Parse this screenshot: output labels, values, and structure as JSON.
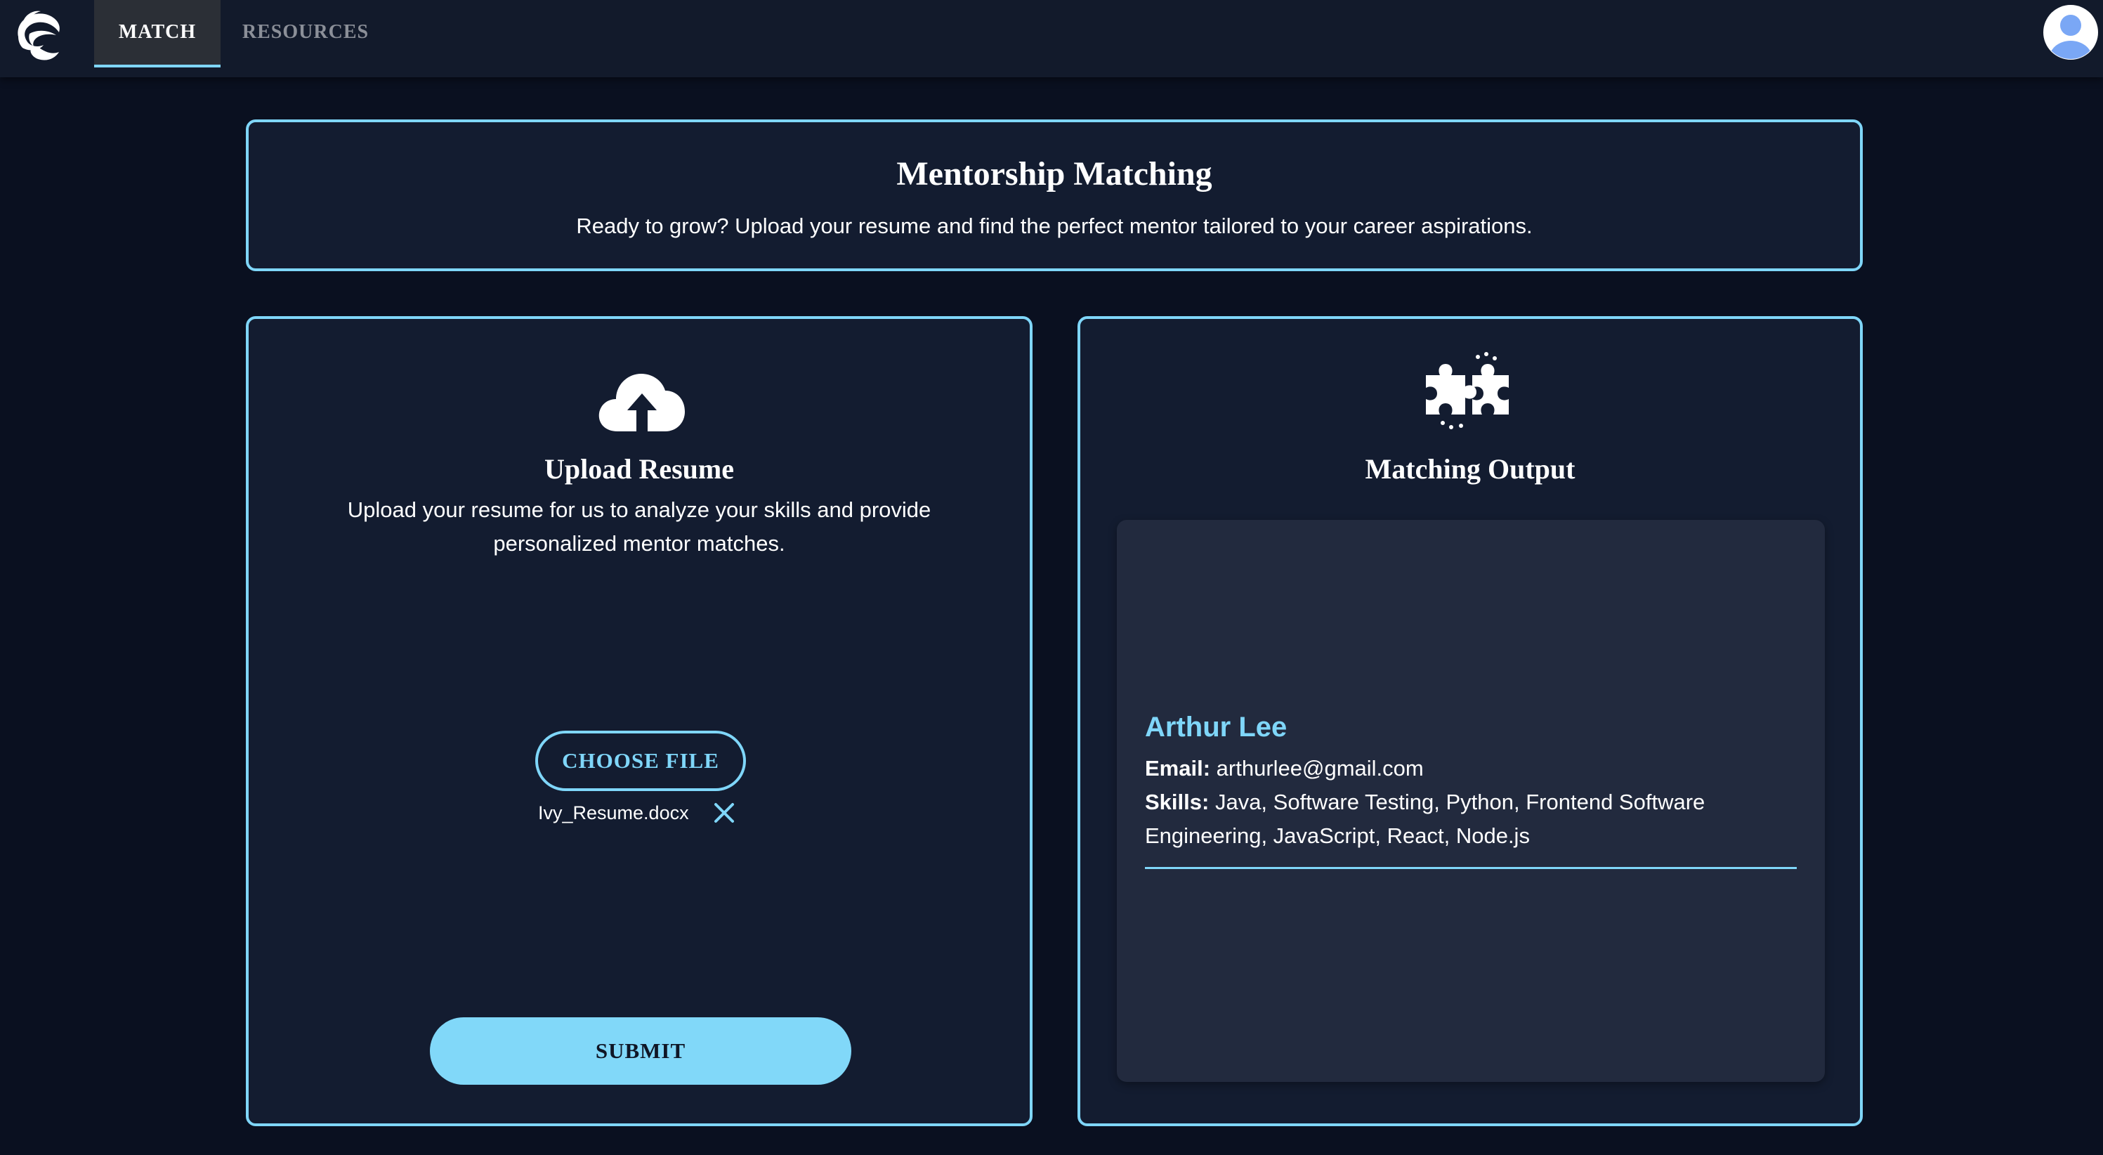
{
  "nav": {
    "tabs": [
      {
        "label": "MATCH",
        "active": true
      },
      {
        "label": "RESOURCES",
        "active": false
      }
    ]
  },
  "header": {
    "title": "Mentorship Matching",
    "subtitle": "Ready to grow? Upload your resume and find the perfect mentor tailored to your career aspirations."
  },
  "upload": {
    "icon": "cloud-upload-icon",
    "title": "Upload Resume",
    "description": "Upload your resume for us to analyze your skills and provide personalized mentor matches.",
    "choose_label": "CHOOSE FILE",
    "file_name": "Ivy_Resume.docx",
    "submit_label": "SUBMIT"
  },
  "output": {
    "icon": "puzzle-icon",
    "title": "Matching Output",
    "mentor": {
      "name": "Arthur Lee",
      "email_label": "Email:",
      "email": "arthurlee@gmail.com",
      "skills_label": "Skills:",
      "skills": "Java, Software Testing, Python, Frontend Software Engineering, JavaScript, React, Node.js"
    }
  },
  "colors": {
    "accent": "#7fd6f9",
    "background": "#0a1020",
    "panel": "#131c30",
    "output_panel": "#222a3e",
    "topbar": "#121a2b"
  }
}
